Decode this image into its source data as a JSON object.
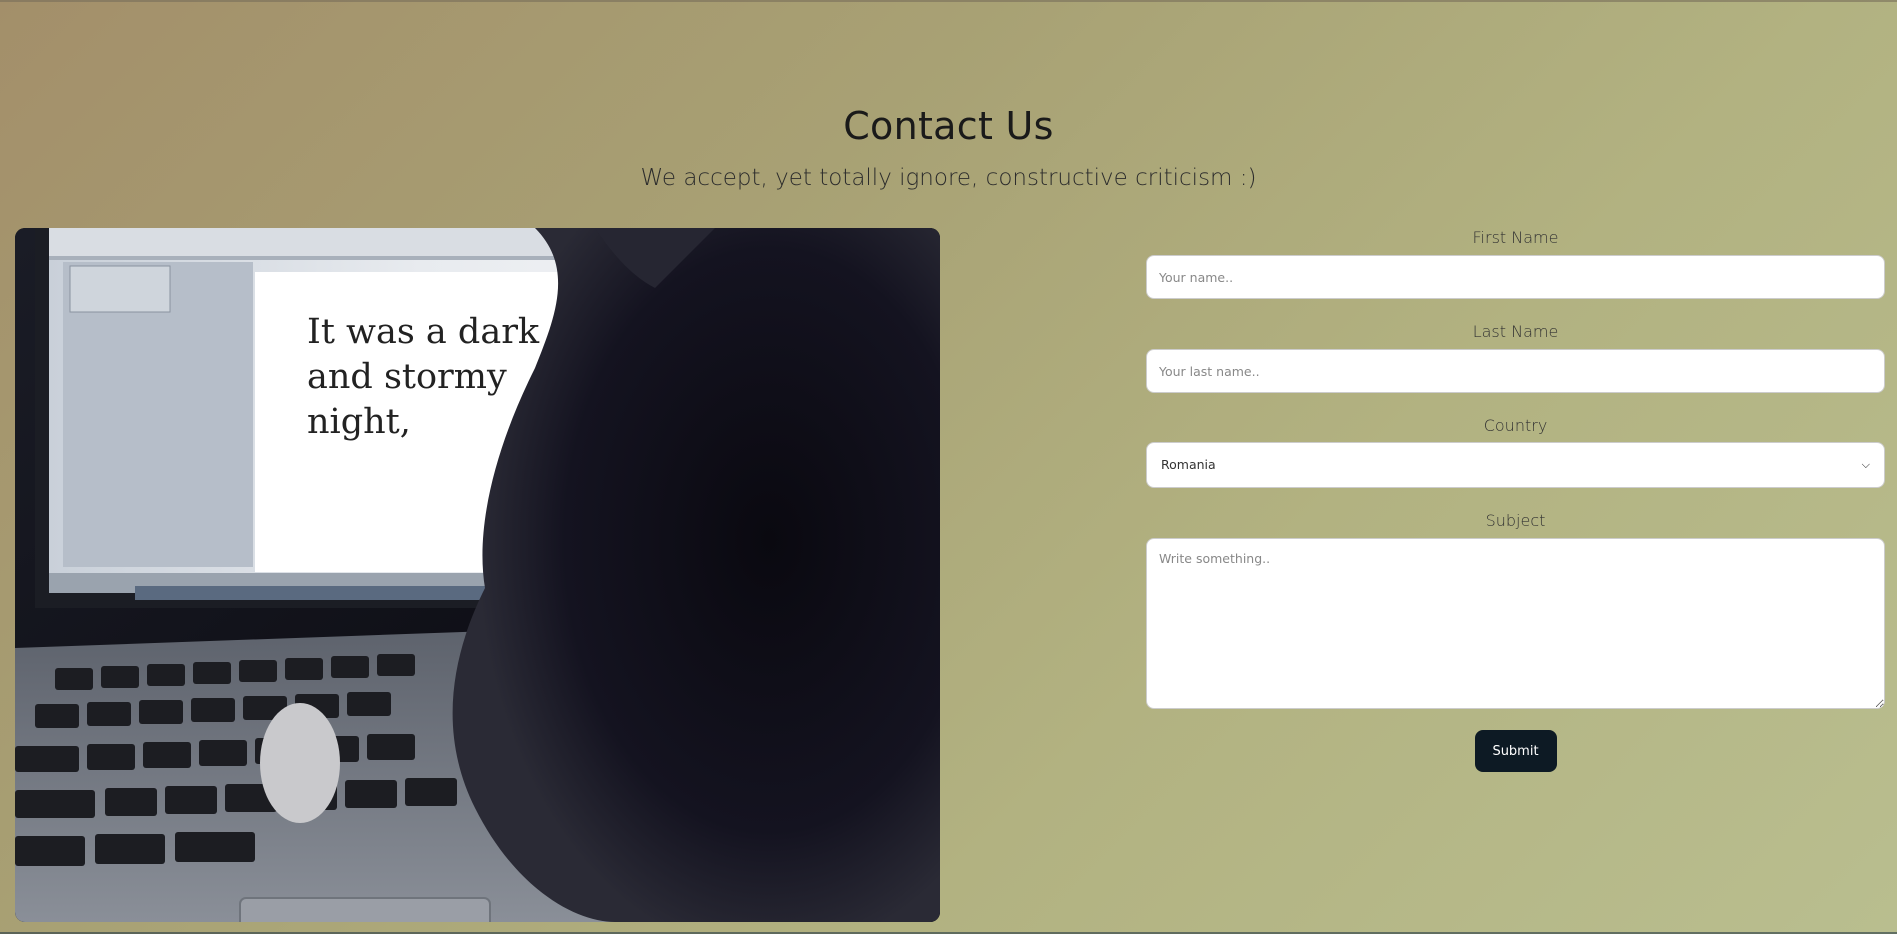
{
  "header": {
    "title": "Contact Us",
    "subtitle": "We accept, yet totally ignore, constructive criticism :)"
  },
  "photo": {
    "screen_text": "It was a dark\nand stormy\nnight,"
  },
  "form": {
    "first_name": {
      "label": "First Name",
      "placeholder": "Your name.."
    },
    "last_name": {
      "label": "Last Name",
      "placeholder": "Your last name.."
    },
    "country": {
      "label": "Country",
      "selected": "Romania"
    },
    "subject": {
      "label": "Subject",
      "placeholder": "Write something.."
    },
    "submit_label": "Submit"
  },
  "icons": {
    "select_arrow": "chevron-down-icon"
  }
}
